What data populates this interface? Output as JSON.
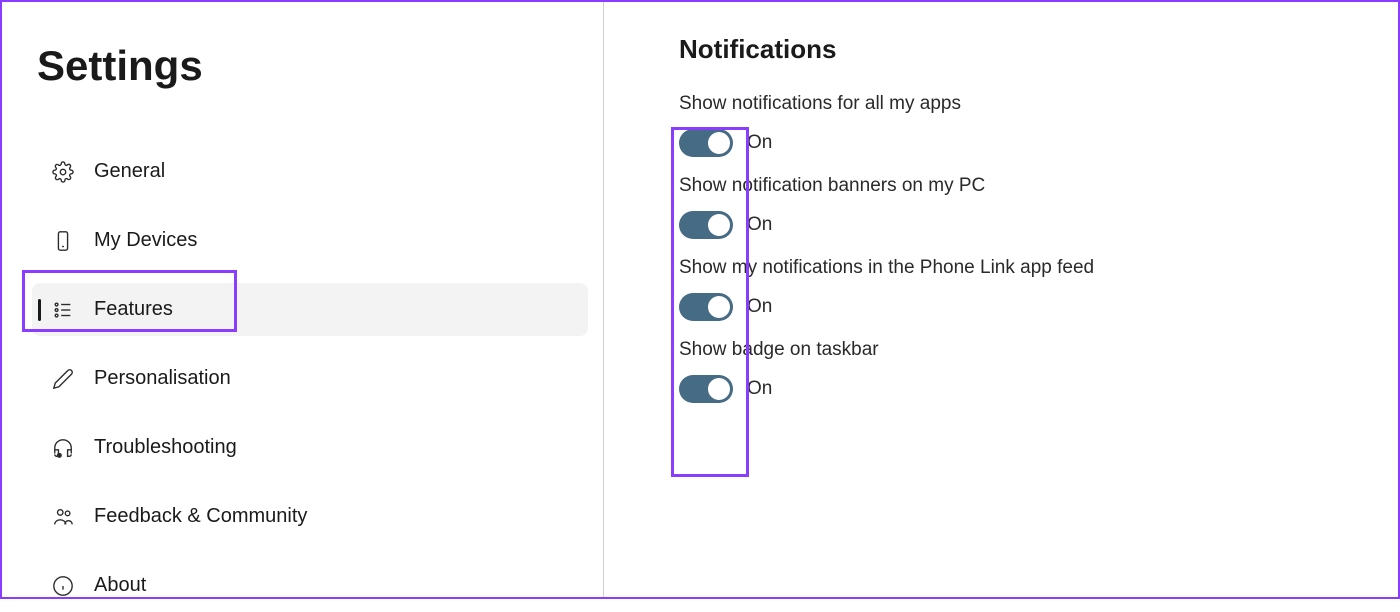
{
  "sidebar": {
    "title": "Settings",
    "items": [
      {
        "label": "General",
        "icon": "gear"
      },
      {
        "label": "My Devices",
        "icon": "phone"
      },
      {
        "label": "Features",
        "icon": "list",
        "selected": true
      },
      {
        "label": "Personalisation",
        "icon": "pen"
      },
      {
        "label": "Troubleshooting",
        "icon": "headset"
      },
      {
        "label": "Feedback & Community",
        "icon": "people"
      },
      {
        "label": "About",
        "icon": "info"
      }
    ]
  },
  "main": {
    "section_title": "Notifications",
    "settings": [
      {
        "label": "Show notifications for all my apps",
        "state": "On"
      },
      {
        "label": "Show notification banners on my PC",
        "state": "On"
      },
      {
        "label": "Show my notifications in the Phone Link app feed",
        "state": "On"
      },
      {
        "label": "Show badge on taskbar",
        "state": "On"
      }
    ]
  }
}
